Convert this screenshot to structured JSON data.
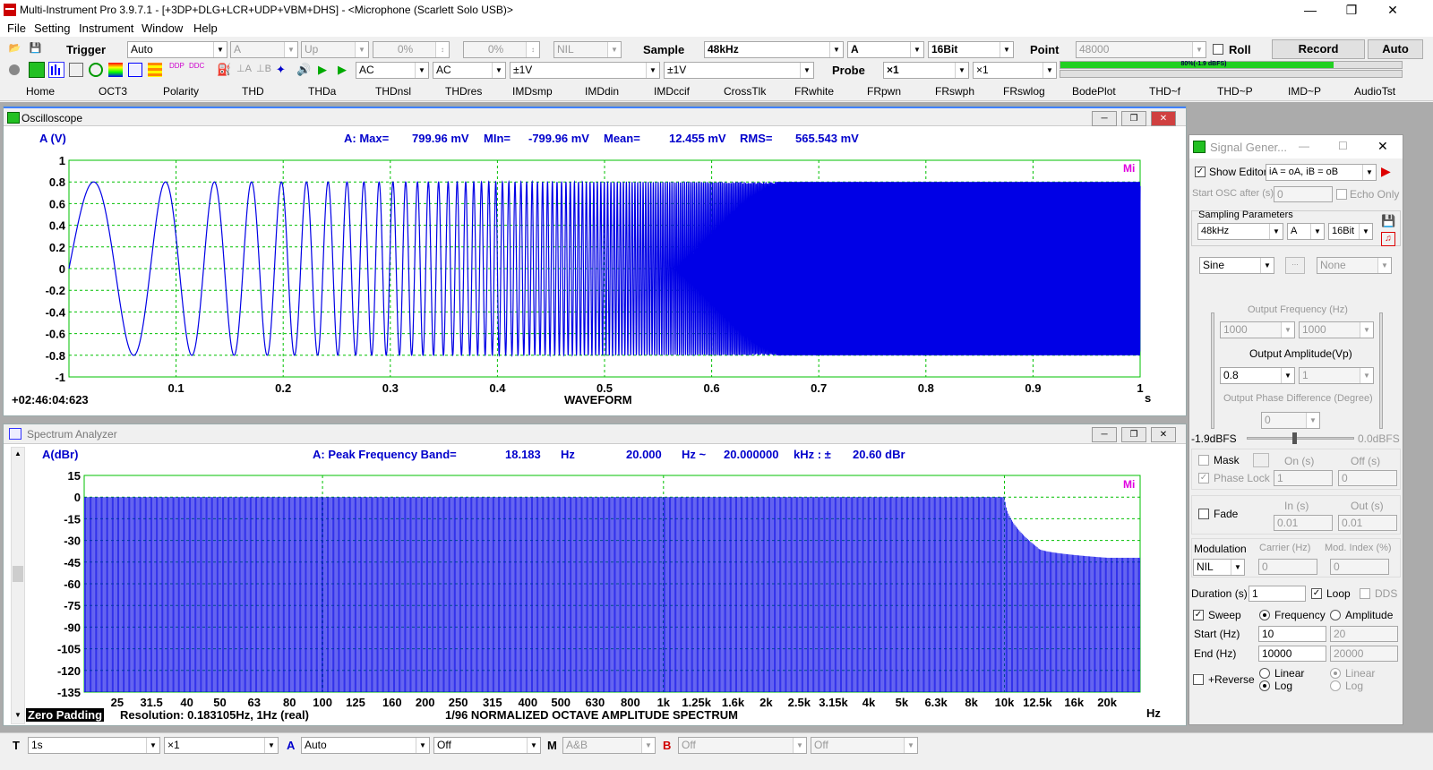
{
  "title": "Multi-Instrument Pro 3.9.7.1   -   [+3DP+DLG+LCR+UDP+VBM+DHS]   -   <Microphone (Scarlett Solo USB)>",
  "menu": [
    "File",
    "Setting",
    "Instrument",
    "Window",
    "Help"
  ],
  "toolbar1": {
    "trigger_label": "Trigger",
    "trigger_mode": "Auto",
    "trigger_ch": "A",
    "trigger_edge": "Up",
    "trigger_level": "0%",
    "trigger_pre": "0%",
    "trigger_nil": "NIL",
    "sample_label": "Sample",
    "sample_rate": "48kHz",
    "sample_ch": "A",
    "sample_bits": "16Bit",
    "point_label": "Point",
    "point_value": "48000",
    "roll_label": "Roll",
    "record_label": "Record",
    "auto_label": "Auto"
  },
  "toolbar2": {
    "coupling_a": "AC",
    "coupling_b": "AC",
    "range_a": "±1V",
    "range_b": "±1V",
    "probe_label": "Probe",
    "probe_a": "×1",
    "probe_b": "×1",
    "level_text": "80%(-1.9 dBFS)",
    "level_fraction": 0.8
  },
  "tabs": [
    "Home",
    "OCT3",
    "Polarity",
    "THD",
    "THDa",
    "THDnsl",
    "THDres",
    "IMDsmp",
    "IMDdin",
    "IMDccif",
    "CrossTlk",
    "FRwhite",
    "FRpwn",
    "FRswph",
    "FRswlog",
    "BodePlot",
    "THD~f",
    "THD~P",
    "IMD~P",
    "AudioTst"
  ],
  "osc": {
    "title": "Oscilloscope",
    "ylabel": "A (V)",
    "stats": {
      "max_label": "A: Max=",
      "max_value": "799.96 mV",
      "min_label": "MIn=",
      "min_value": "-799.96 mV",
      "mean_label": "Mean=",
      "mean_value": "12.455 mV",
      "rms_label": "RMS=",
      "rms_value": "565.543 mV"
    },
    "yticks": [
      "1",
      "0.8",
      "0.6",
      "0.4",
      "0.2",
      "0",
      "-0.2",
      "-0.4",
      "-0.6",
      "-0.8",
      "-1"
    ],
    "xticks": [
      "0.1",
      "0.2",
      "0.3",
      "0.4",
      "0.5",
      "0.6",
      "0.7",
      "0.8",
      "0.9",
      "1"
    ],
    "xunit": "s",
    "time": "+02:46:04:623",
    "caption": "WAVEFORM",
    "mi": "Mi"
  },
  "spec": {
    "title": "Spectrum Analyzer",
    "ylabel": "A(dBr)",
    "stats": {
      "label": "A: Peak Frequency Band=",
      "peak": "18.183",
      "u1": "Hz",
      "f1": "20.000",
      "u2": "Hz ~",
      "f2": "20.000000",
      "u3": "kHz : ±",
      "dbr": "20.60 dBr"
    },
    "yticks": [
      "15",
      "0",
      "-15",
      "-30",
      "-45",
      "-60",
      "-75",
      "-90",
      "-105",
      "-120",
      "-135"
    ],
    "xticks": [
      "25",
      "31.5",
      "40",
      "50",
      "63",
      "80",
      "100",
      "125",
      "160",
      "200",
      "250",
      "315",
      "400",
      "500",
      "630",
      "800",
      "1k",
      "1.25k",
      "1.6k",
      "2k",
      "2.5k",
      "3.15k",
      "4k",
      "5k",
      "6.3k",
      "8k",
      "10k",
      "12.5k",
      "16k",
      "20k"
    ],
    "xunit": "Hz",
    "zero_padding": "Zero Padding",
    "resolution": "Resolution: 0.183105Hz, 1Hz (real)",
    "caption": "1/96 NORMALIZED OCTAVE AMPLITUDE SPECTRUM",
    "mi": "Mi"
  },
  "chart_data": [
    {
      "type": "line",
      "title": "WAVEFORM",
      "xlabel": "s",
      "ylabel": "A (V)",
      "xlim": [
        0,
        1
      ],
      "ylim": [
        -1,
        1
      ],
      "grid": true,
      "description_values": {
        "amplitude": 0.8,
        "sweep_start_hz": 10,
        "sweep_end_hz": 10000
      }
    },
    {
      "type": "bar",
      "title": "1/96 NORMALIZED OCTAVE AMPLITUDE SPECTRUM",
      "xlabel": "Hz",
      "ylabel": "A(dBr)",
      "ylim": [
        -135,
        15
      ],
      "grid": true,
      "x": [
        20,
        10000,
        12500,
        20000
      ],
      "values": [
        0,
        0,
        -35,
        -42
      ]
    }
  ],
  "siggen": {
    "title": "Signal Gener...",
    "show_editor": "Show Editor",
    "editor_value": "iA = oA, iB = oB",
    "start_osc": "Start OSC after (s)",
    "start_osc_value": "0",
    "echo_only": "Echo Only",
    "sampling_params": "Sampling Parameters",
    "rate": "48kHz",
    "ch": "A",
    "bits": "16Bit",
    "wave": "Sine",
    "wave_b": "None",
    "out_freq_label": "Output Frequency (Hz)",
    "freq_a": "1000",
    "freq_b": "1000",
    "out_amp_label": "Output Amplitude(Vp)",
    "amp_a": "0.8",
    "amp_b": "1",
    "phase_label": "Output Phase Difference (Degree)",
    "phase": "0",
    "dbfs_left": "-1.9dBFS",
    "dbfs_right": "0.0dBFS",
    "mask": "Mask",
    "on_s": "On (s)",
    "off_s": "Off (s)",
    "phase_lock": "Phase Lock",
    "on_val": "1",
    "off_val": "0",
    "fade": "Fade",
    "in_s": "In (s)",
    "out_s": "Out (s)",
    "in_val": "0.01",
    "out_val": "0.01",
    "modulation": "Modulation",
    "carrier": "Carrier (Hz)",
    "mod_index": "Mod. Index (%)",
    "mod_value": "NIL",
    "carrier_val": "0",
    "index_val": "0",
    "duration": "Duration (s)",
    "duration_val": "1",
    "loop": "Loop",
    "dds": "DDS",
    "sweep": "Sweep",
    "frequency": "Frequency",
    "amplitude": "Amplitude",
    "start_hz": "Start (Hz)",
    "start_a": "10",
    "start_b": "20",
    "end_hz": "End (Hz)",
    "end_a": "10000",
    "end_b": "20000",
    "reverse": "+Reverse",
    "linear": "Linear",
    "log": "Log"
  },
  "status": {
    "t_label": "T",
    "t_value": "1s",
    "t_mult": "×1",
    "a_label": "A",
    "a_value": "Auto",
    "a_off": "Off",
    "m_label": "M",
    "m_value": "A&B",
    "b_label": "B",
    "b_value": "Off",
    "b_off": "Off"
  },
  "colors": {
    "trace": "#0000e6",
    "grid": "#00c000",
    "accent_red": "#d00000",
    "mi": "#e000e0"
  }
}
